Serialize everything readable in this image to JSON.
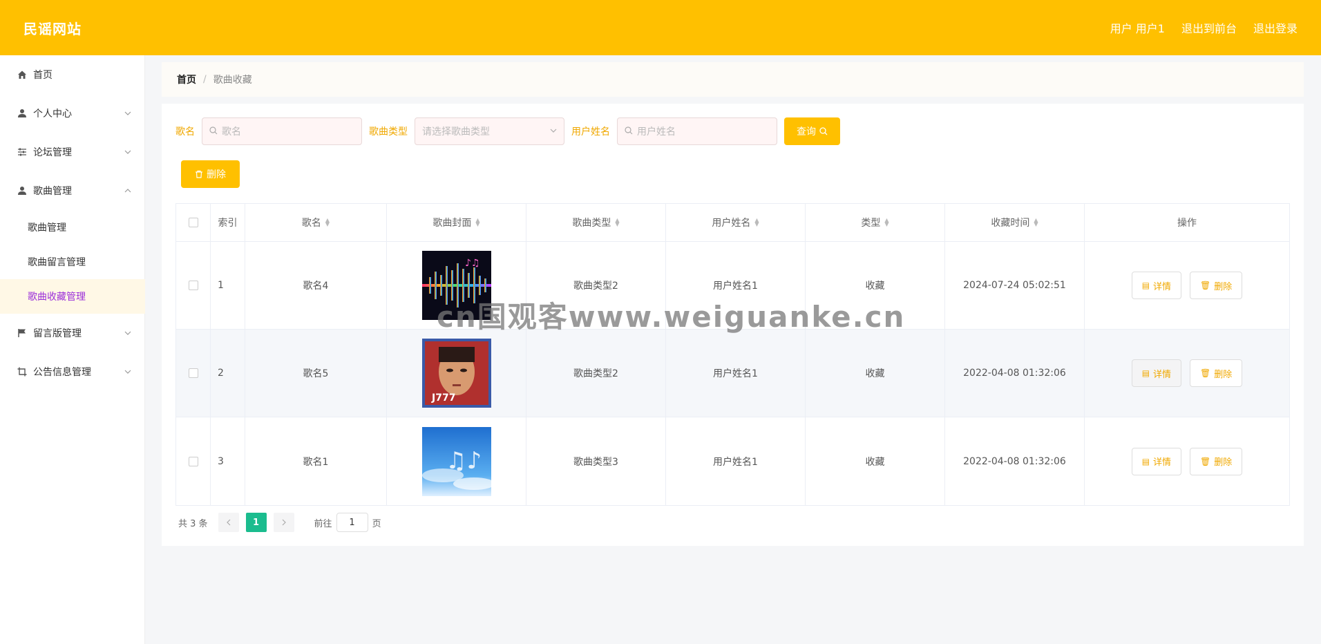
{
  "header": {
    "brand": "民谣网站",
    "user": "用户 用户1",
    "to_front": "退出到前台",
    "logout": "退出登录"
  },
  "sidebar": {
    "items": [
      {
        "label": "首页",
        "icon": "home-icon"
      },
      {
        "label": "个人中心",
        "icon": "user-icon"
      },
      {
        "label": "论坛管理",
        "icon": "sliders-icon"
      },
      {
        "label": "歌曲管理",
        "icon": "user-icon"
      },
      {
        "label": "留言版管理",
        "icon": "flag-icon"
      },
      {
        "label": "公告信息管理",
        "icon": "crop-icon"
      }
    ],
    "sub_items": [
      "歌曲管理",
      "歌曲留言管理",
      "歌曲收藏管理"
    ]
  },
  "breadcrumb": {
    "home": "首页",
    "sep": "/",
    "current": "歌曲收藏"
  },
  "search": {
    "song_label": "歌名",
    "song_placeholder": "歌名",
    "type_label": "歌曲类型",
    "type_placeholder": "请选择歌曲类型",
    "user_label": "用户姓名",
    "user_placeholder": "用户姓名",
    "query_button": "查询"
  },
  "toolbar": {
    "delete_label": "删除"
  },
  "table": {
    "headers": [
      "索引",
      "歌名",
      "歌曲封面",
      "歌曲类型",
      "用户姓名",
      "类型",
      "收藏时间",
      "操作"
    ],
    "rows": [
      {
        "index": "1",
        "name": "歌名4",
        "type": "歌曲类型2",
        "user": "用户姓名1",
        "kind": "收藏",
        "time": "2024-07-24 05:02:51"
      },
      {
        "index": "2",
        "name": "歌名5",
        "type": "歌曲类型2",
        "user": "用户姓名1",
        "kind": "收藏",
        "time": "2022-04-08 01:32:06"
      },
      {
        "index": "3",
        "name": "歌名1",
        "type": "歌曲类型3",
        "user": "用户姓名1",
        "kind": "收藏",
        "time": "2022-04-08 01:32:06"
      }
    ],
    "detail_label": "详情",
    "delete_label": "删除"
  },
  "pager": {
    "total": "共 3 条",
    "current": "1",
    "goto_prefix": "前往",
    "goto_value": "1",
    "goto_suffix": "页"
  },
  "watermark": "cn国观客www.weiguanke.cn",
  "colors": {
    "accent": "#ffc000",
    "active_text": "#9b2fd9",
    "pager_active": "#1bbc8e"
  }
}
